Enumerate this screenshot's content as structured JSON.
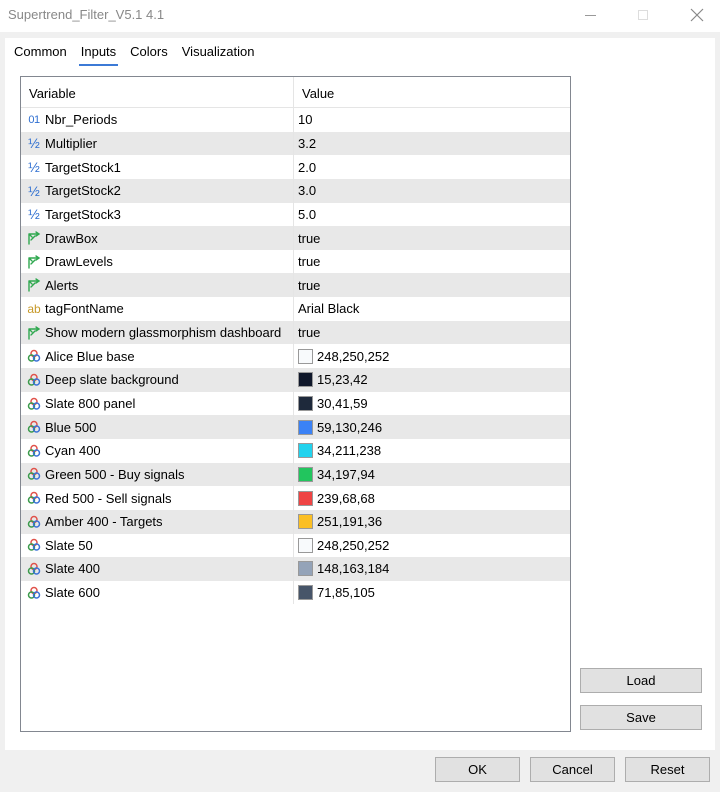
{
  "window": {
    "title": "Supertrend_Filter_V5.1 4.1"
  },
  "tabs": [
    {
      "label": "Common"
    },
    {
      "label": "Inputs",
      "active": true
    },
    {
      "label": "Colors"
    },
    {
      "label": "Visualization"
    }
  ],
  "grid": {
    "headers": {
      "variable": "Variable",
      "value": "Value"
    },
    "rows": [
      {
        "icon": "integer-icon",
        "name": "Nbr_Periods",
        "value": "10"
      },
      {
        "icon": "double-icon",
        "name": "Multiplier",
        "value": "3.2"
      },
      {
        "icon": "double-icon",
        "name": "TargetStock1",
        "value": "2.0"
      },
      {
        "icon": "double-icon",
        "name": "TargetStock2",
        "value": "3.0"
      },
      {
        "icon": "double-icon",
        "name": "TargetStock3",
        "value": "5.0"
      },
      {
        "icon": "bool-icon",
        "name": "DrawBox",
        "value": "true"
      },
      {
        "icon": "bool-icon",
        "name": "DrawLevels",
        "value": "true"
      },
      {
        "icon": "bool-icon",
        "name": "Alerts",
        "value": "true"
      },
      {
        "icon": "string-icon",
        "name": "tagFontName",
        "value": "Arial Black"
      },
      {
        "icon": "bool-icon",
        "name": "Show modern glassmorphism dashboard",
        "value": "true"
      },
      {
        "icon": "color-icon",
        "name": "Alice Blue base",
        "value": "248,250,252",
        "color": "#f8fafc"
      },
      {
        "icon": "color-icon",
        "name": "Deep slate background",
        "value": "15,23,42",
        "color": "#0f172a"
      },
      {
        "icon": "color-icon",
        "name": "Slate 800 panel",
        "value": "30,41,59",
        "color": "#1e293b"
      },
      {
        "icon": "color-icon",
        "name": "Blue 500",
        "value": "59,130,246",
        "color": "#3b82f6"
      },
      {
        "icon": "color-icon",
        "name": "Cyan 400",
        "value": "34,211,238",
        "color": "#22d3ee"
      },
      {
        "icon": "color-icon",
        "name": "Green 500 - Buy signals",
        "value": "34,197,94",
        "color": "#22c55e"
      },
      {
        "icon": "color-icon",
        "name": "Red 500 - Sell signals",
        "value": "239,68,68",
        "color": "#ef4444"
      },
      {
        "icon": "color-icon",
        "name": "Amber 400 - Targets",
        "value": "251,191,36",
        "color": "#fbbf24"
      },
      {
        "icon": "color-icon",
        "name": "Slate 50",
        "value": "248,250,252",
        "color": "#f8fafc"
      },
      {
        "icon": "color-icon",
        "name": "Slate 400",
        "value": "148,163,184",
        "color": "#94a3b8"
      },
      {
        "icon": "color-icon",
        "name": "Slate 600",
        "value": "71,85,105",
        "color": "#475569"
      }
    ]
  },
  "buttons": {
    "load": "Load",
    "save": "Save",
    "ok": "OK",
    "cancel": "Cancel",
    "reset": "Reset"
  }
}
